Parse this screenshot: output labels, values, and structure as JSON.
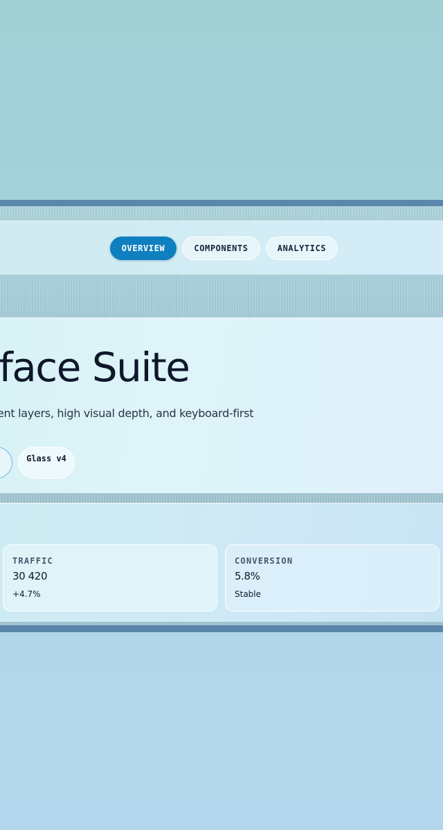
{
  "nav": {
    "tabs": [
      {
        "label": "OVERVIEW",
        "active": true
      },
      {
        "label": "COMPONENTS",
        "active": false
      },
      {
        "label": "ANALYTICS",
        "active": false
      }
    ]
  },
  "hero": {
    "title": "rface Suite",
    "subtitle": "ent layers, high visual depth, and keyboard-first",
    "chips": [
      {
        "label": ""
      },
      {
        "label": "Glass v4"
      }
    ]
  },
  "metrics": [
    {
      "label": "TRAFFIC",
      "value": "30 420",
      "note": "+4.7%"
    },
    {
      "label": "CONVERSION",
      "value": "5.8%",
      "note": "Stable"
    }
  ],
  "colors": {
    "accent": "#0f7fc0",
    "band": "#5a86ab",
    "background": "#a1cfd4",
    "text": "#10192b"
  }
}
